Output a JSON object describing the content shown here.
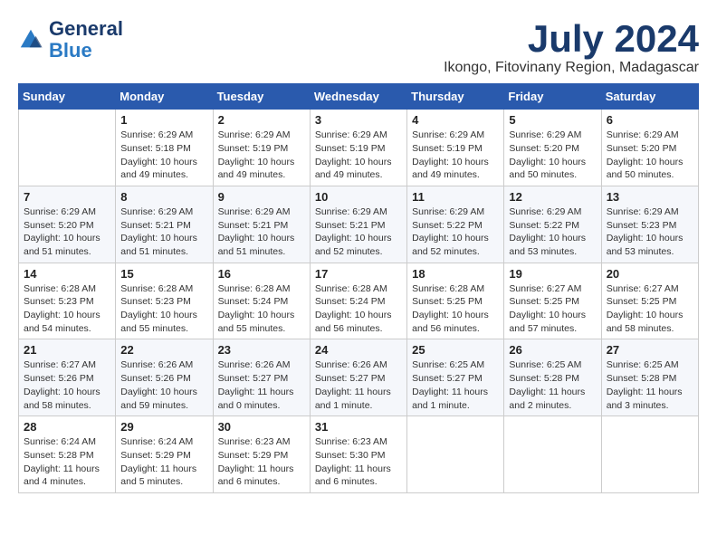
{
  "logo": {
    "text_general": "General",
    "text_blue": "Blue"
  },
  "header": {
    "month_year": "July 2024",
    "location": "Ikongo, Fitovinany Region, Madagascar"
  },
  "weekdays": [
    "Sunday",
    "Monday",
    "Tuesday",
    "Wednesday",
    "Thursday",
    "Friday",
    "Saturday"
  ],
  "weeks": [
    [
      {
        "day": "",
        "sunrise": "",
        "sunset": "",
        "daylight": ""
      },
      {
        "day": "1",
        "sunrise": "Sunrise: 6:29 AM",
        "sunset": "Sunset: 5:18 PM",
        "daylight": "Daylight: 10 hours and 49 minutes."
      },
      {
        "day": "2",
        "sunrise": "Sunrise: 6:29 AM",
        "sunset": "Sunset: 5:19 PM",
        "daylight": "Daylight: 10 hours and 49 minutes."
      },
      {
        "day": "3",
        "sunrise": "Sunrise: 6:29 AM",
        "sunset": "Sunset: 5:19 PM",
        "daylight": "Daylight: 10 hours and 49 minutes."
      },
      {
        "day": "4",
        "sunrise": "Sunrise: 6:29 AM",
        "sunset": "Sunset: 5:19 PM",
        "daylight": "Daylight: 10 hours and 49 minutes."
      },
      {
        "day": "5",
        "sunrise": "Sunrise: 6:29 AM",
        "sunset": "Sunset: 5:20 PM",
        "daylight": "Daylight: 10 hours and 50 minutes."
      },
      {
        "day": "6",
        "sunrise": "Sunrise: 6:29 AM",
        "sunset": "Sunset: 5:20 PM",
        "daylight": "Daylight: 10 hours and 50 minutes."
      }
    ],
    [
      {
        "day": "7",
        "sunrise": "Sunrise: 6:29 AM",
        "sunset": "Sunset: 5:20 PM",
        "daylight": "Daylight: 10 hours and 51 minutes."
      },
      {
        "day": "8",
        "sunrise": "Sunrise: 6:29 AM",
        "sunset": "Sunset: 5:21 PM",
        "daylight": "Daylight: 10 hours and 51 minutes."
      },
      {
        "day": "9",
        "sunrise": "Sunrise: 6:29 AM",
        "sunset": "Sunset: 5:21 PM",
        "daylight": "Daylight: 10 hours and 51 minutes."
      },
      {
        "day": "10",
        "sunrise": "Sunrise: 6:29 AM",
        "sunset": "Sunset: 5:21 PM",
        "daylight": "Daylight: 10 hours and 52 minutes."
      },
      {
        "day": "11",
        "sunrise": "Sunrise: 6:29 AM",
        "sunset": "Sunset: 5:22 PM",
        "daylight": "Daylight: 10 hours and 52 minutes."
      },
      {
        "day": "12",
        "sunrise": "Sunrise: 6:29 AM",
        "sunset": "Sunset: 5:22 PM",
        "daylight": "Daylight: 10 hours and 53 minutes."
      },
      {
        "day": "13",
        "sunrise": "Sunrise: 6:29 AM",
        "sunset": "Sunset: 5:23 PM",
        "daylight": "Daylight: 10 hours and 53 minutes."
      }
    ],
    [
      {
        "day": "14",
        "sunrise": "Sunrise: 6:28 AM",
        "sunset": "Sunset: 5:23 PM",
        "daylight": "Daylight: 10 hours and 54 minutes."
      },
      {
        "day": "15",
        "sunrise": "Sunrise: 6:28 AM",
        "sunset": "Sunset: 5:23 PM",
        "daylight": "Daylight: 10 hours and 55 minutes."
      },
      {
        "day": "16",
        "sunrise": "Sunrise: 6:28 AM",
        "sunset": "Sunset: 5:24 PM",
        "daylight": "Daylight: 10 hours and 55 minutes."
      },
      {
        "day": "17",
        "sunrise": "Sunrise: 6:28 AM",
        "sunset": "Sunset: 5:24 PM",
        "daylight": "Daylight: 10 hours and 56 minutes."
      },
      {
        "day": "18",
        "sunrise": "Sunrise: 6:28 AM",
        "sunset": "Sunset: 5:25 PM",
        "daylight": "Daylight: 10 hours and 56 minutes."
      },
      {
        "day": "19",
        "sunrise": "Sunrise: 6:27 AM",
        "sunset": "Sunset: 5:25 PM",
        "daylight": "Daylight: 10 hours and 57 minutes."
      },
      {
        "day": "20",
        "sunrise": "Sunrise: 6:27 AM",
        "sunset": "Sunset: 5:25 PM",
        "daylight": "Daylight: 10 hours and 58 minutes."
      }
    ],
    [
      {
        "day": "21",
        "sunrise": "Sunrise: 6:27 AM",
        "sunset": "Sunset: 5:26 PM",
        "daylight": "Daylight: 10 hours and 58 minutes."
      },
      {
        "day": "22",
        "sunrise": "Sunrise: 6:26 AM",
        "sunset": "Sunset: 5:26 PM",
        "daylight": "Daylight: 10 hours and 59 minutes."
      },
      {
        "day": "23",
        "sunrise": "Sunrise: 6:26 AM",
        "sunset": "Sunset: 5:27 PM",
        "daylight": "Daylight: 11 hours and 0 minutes."
      },
      {
        "day": "24",
        "sunrise": "Sunrise: 6:26 AM",
        "sunset": "Sunset: 5:27 PM",
        "daylight": "Daylight: 11 hours and 1 minute."
      },
      {
        "day": "25",
        "sunrise": "Sunrise: 6:25 AM",
        "sunset": "Sunset: 5:27 PM",
        "daylight": "Daylight: 11 hours and 1 minute."
      },
      {
        "day": "26",
        "sunrise": "Sunrise: 6:25 AM",
        "sunset": "Sunset: 5:28 PM",
        "daylight": "Daylight: 11 hours and 2 minutes."
      },
      {
        "day": "27",
        "sunrise": "Sunrise: 6:25 AM",
        "sunset": "Sunset: 5:28 PM",
        "daylight": "Daylight: 11 hours and 3 minutes."
      }
    ],
    [
      {
        "day": "28",
        "sunrise": "Sunrise: 6:24 AM",
        "sunset": "Sunset: 5:28 PM",
        "daylight": "Daylight: 11 hours and 4 minutes."
      },
      {
        "day": "29",
        "sunrise": "Sunrise: 6:24 AM",
        "sunset": "Sunset: 5:29 PM",
        "daylight": "Daylight: 11 hours and 5 minutes."
      },
      {
        "day": "30",
        "sunrise": "Sunrise: 6:23 AM",
        "sunset": "Sunset: 5:29 PM",
        "daylight": "Daylight: 11 hours and 6 minutes."
      },
      {
        "day": "31",
        "sunrise": "Sunrise: 6:23 AM",
        "sunset": "Sunset: 5:30 PM",
        "daylight": "Daylight: 11 hours and 6 minutes."
      },
      {
        "day": "",
        "sunrise": "",
        "sunset": "",
        "daylight": ""
      },
      {
        "day": "",
        "sunrise": "",
        "sunset": "",
        "daylight": ""
      },
      {
        "day": "",
        "sunrise": "",
        "sunset": "",
        "daylight": ""
      }
    ]
  ]
}
